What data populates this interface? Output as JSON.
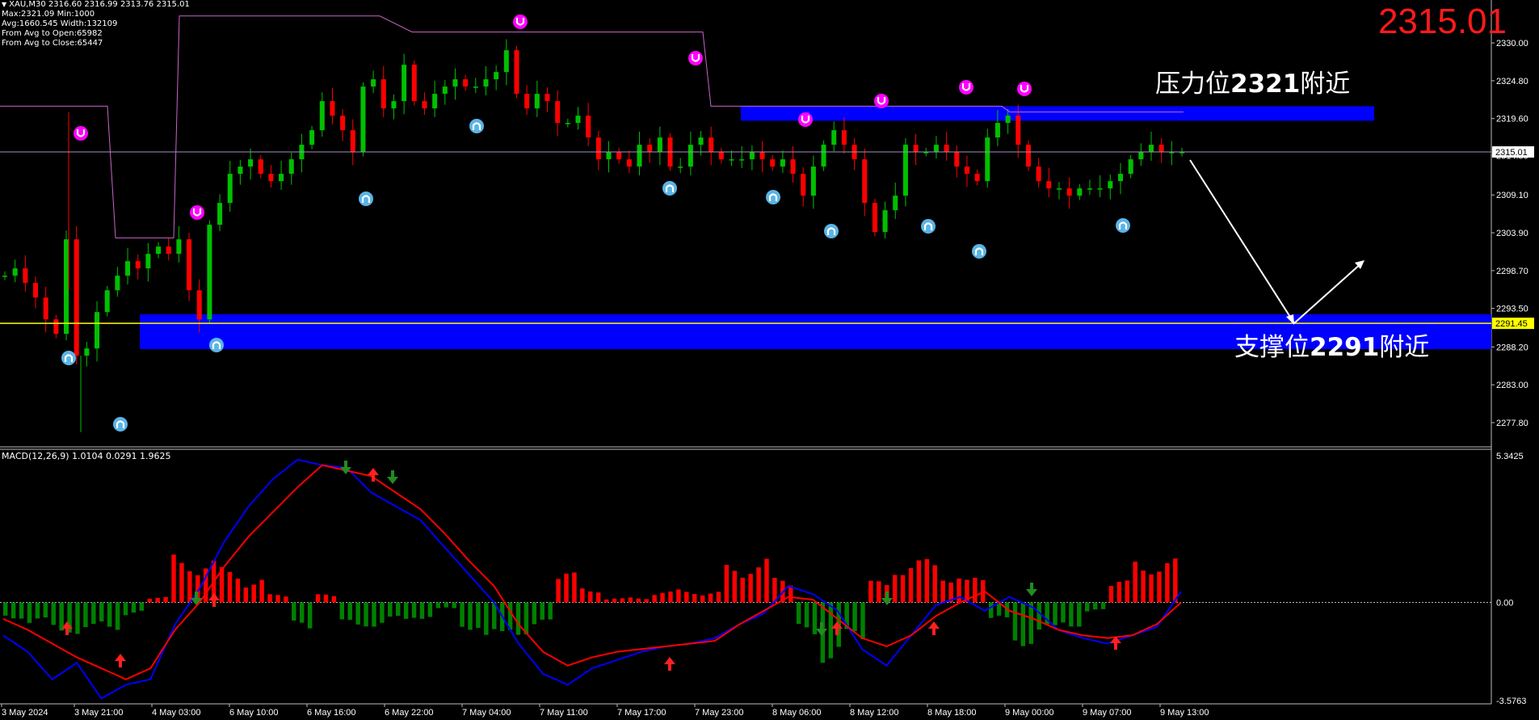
{
  "info": {
    "symbol_line": "XAU,M30  2316.60 2316.99 2313.76 2315.01",
    "max_min": "Max:2321.09 Min:1000",
    "avg_width": "Avg:1660.545 Width:132109",
    "avg_open": "From Avg to Open:65982",
    "avg_close": "From Avg to Close:65447"
  },
  "big_price": "2315.01",
  "resistance": {
    "prefix": "压力位",
    "value": "2321",
    "suffix": "附近"
  },
  "support": {
    "prefix": "支撑位",
    "value": "2291",
    "suffix": "附近"
  },
  "macd_title": "MACD(12,26,9) 1.0104 0.0291 1.9625",
  "colors": {
    "bull": "#00c000",
    "bear": "#ff0000",
    "zone": "#0000ff",
    "macd_line": "#0000ff",
    "signal_line": "#ff0000",
    "hist_pos": "#ff0000",
    "hist_neg": "#008000",
    "upper_fractal": "#ff00ff",
    "lower_fractal": "#5ab4e6",
    "step_line": "#c864c8",
    "support_line": "#ffff00",
    "current_line": "#a090c0"
  },
  "chart_data": [
    {
      "type": "candlestick",
      "title": "XAU,M30",
      "ylim": [
        2274.8,
        2335.9
      ],
      "y_ticks": [
        "2330.00",
        "2324.80",
        "2319.60",
        "2314.50",
        "2309.10",
        "2303.90",
        "2298.70",
        "2293.50",
        "2288.20",
        "2283.00",
        "2277.80"
      ],
      "x_ticks": [
        "3 May 2024",
        "3 May 21:00",
        "4 May 03:00",
        "6 May 10:00",
        "6 May 16:00",
        "6 May 22:00",
        "7 May 04:00",
        "7 May 11:00",
        "7 May 17:00",
        "7 May 23:00",
        "8 May 06:00",
        "8 May 12:00",
        "8 May 18:00",
        "9 May 00:00",
        "9 May 07:00",
        "9 May 13:00"
      ],
      "current_price": "2315.01",
      "support_price": "2291.45",
      "resistance_zone": [
        2319.3,
        2321.3
      ],
      "support_zone": [
        2287.9,
        2292.7
      ],
      "anchors": [
        2298,
        2299,
        2297,
        2295,
        2292,
        2290,
        2303,
        2287,
        2288,
        2293,
        2296,
        2298,
        2300,
        2299,
        2301,
        2302,
        2301,
        2303,
        2296,
        2292,
        2305,
        2308,
        2312,
        2313,
        2314,
        2312,
        2311,
        2312,
        2314,
        2316,
        2318,
        2322,
        2320,
        2318,
        2315,
        2324,
        2325,
        2321,
        2322,
        2327,
        2322,
        2321,
        2323,
        2324,
        2325,
        2324,
        2324,
        2325,
        2326,
        2329,
        2323,
        2321,
        2323,
        2322,
        2319,
        2319,
        2320,
        2317,
        2314,
        2315,
        2314,
        2313,
        2316,
        2315,
        2317,
        2313,
        2313,
        2316,
        2317,
        2315,
        2314,
        2314,
        2314,
        2315,
        2314,
        2313,
        2314,
        2312,
        2309,
        2313,
        2316,
        2318,
        2316,
        2314,
        2308,
        2304,
        2307,
        2309,
        2316,
        2315,
        2315,
        2316,
        2315,
        2313,
        2312,
        2311,
        2317,
        2319,
        2320,
        2316,
        2313,
        2311,
        2310,
        2310,
        2309,
        2310,
        2310,
        2310,
        2311,
        2312,
        2314,
        2315,
        2316,
        2315,
        2315,
        2315
      ],
      "series": [
        {
          "name": "MACD",
          "values": [
            -1.2,
            -1.8,
            -2.8,
            -2.2,
            -3.5,
            -3.0,
            -2.8,
            -0.8,
            0.5,
            2.2,
            3.5,
            4.5,
            5.2,
            5.0,
            4.9,
            4.0,
            3.5,
            3.0,
            2.0,
            1.0,
            0,
            -1.5,
            -2.6,
            -3.0,
            -2.4,
            -2.1,
            -1.8,
            -1.6,
            -1.5,
            -1.3,
            -0.8,
            -0.4,
            0.6,
            0.3,
            -0.3,
            -1.7,
            -2.3,
            -1.2,
            -0.1,
            0.2,
            -0.3,
            0.2,
            -0.2,
            -1.0,
            -1.3,
            -1.5,
            -1.2,
            -0.9,
            0.4
          ]
        },
        {
          "name": "Signal",
          "values": [
            -0.6,
            -1.0,
            -1.5,
            -2.0,
            -2.4,
            -2.8,
            -2.4,
            -1.0,
            0,
            1.3,
            2.4,
            3.3,
            4.2,
            5.0,
            4.8,
            4.6,
            4.0,
            3.4,
            2.5,
            1.5,
            0.6,
            -0.8,
            -1.8,
            -2.3,
            -2.0,
            -1.8,
            -1.7,
            -1.6,
            -1.5,
            -1.4,
            -0.8,
            -0.3,
            0.2,
            0.1,
            -0.6,
            -1.3,
            -1.6,
            -1.2,
            -0.5,
            0,
            0.4,
            -0.3,
            -0.6,
            -1.0,
            -1.2,
            -1.3,
            -1.2,
            -0.8,
            0
          ]
        },
        {
          "name": "Histogram",
          "values": [
            -0.6,
            -0.9,
            -1.1,
            -1.3,
            -1.0,
            -0.5,
            0.2,
            1.8,
            1.6,
            1.3,
            0.9,
            0.3,
            -1.1,
            0.3,
            -1.0,
            -0.9,
            -0.8,
            -0.6,
            -0.3,
            -1.0,
            -1.6,
            -1.2,
            -1.0,
            1.1,
            0.6,
            0.15,
            0.2,
            0.4,
            0.5,
            0.4,
            1.4,
            1.7,
            0.9,
            -1.3,
            -2.2,
            -1.6,
            0.8,
            1.6,
            1.6,
            1.2,
            0.9,
            -0.8,
            -1.6,
            -1.3,
            -0.9,
            -0.4,
            0.8,
            1.7,
            1.6
          ]
        }
      ],
      "macd_ylim": [
        -3.5763,
        5.3425
      ],
      "macd_y_ticks": [
        "5.3425",
        "0.00",
        "-3.5763"
      ]
    }
  ]
}
